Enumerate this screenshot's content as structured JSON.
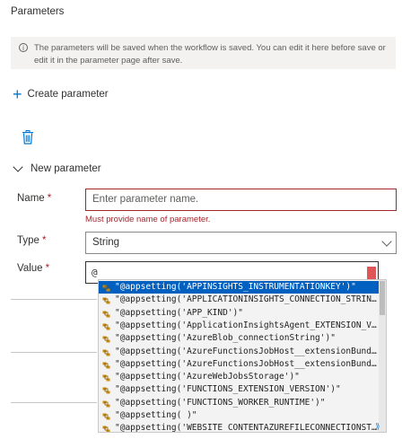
{
  "panel": {
    "title": "Parameters",
    "info_text": "The parameters will be saved when the workflow is saved. You can edit it here before save or edit it in the parameter page after save.",
    "create_label": "Create parameter",
    "section_title": "New parameter"
  },
  "form": {
    "name_label": "Name",
    "required_mark": "*",
    "name_placeholder": "Enter parameter name.",
    "name_value": "",
    "name_error": "Must provide name of parameter.",
    "type_label": "Type",
    "type_value": "String",
    "value_label": "Value",
    "value_text": "@"
  },
  "suggestions": [
    "\"@appsetting('APPINSIGHTS_INSTRUMENTATIONKEY')\"",
    "\"@appsetting('APPLICATIONINSIGHTS_CONNECTION_STRIN…",
    "\"@appsetting('APP_KIND')\"",
    "\"@appsetting('ApplicationInsightsAgent_EXTENSION_V…",
    "\"@appsetting('AzureBlob_connectionString')\"",
    "\"@appsetting('AzureFunctionsJobHost__extensionBund…",
    "\"@appsetting('AzureFunctionsJobHost__extensionBund…",
    "\"@appsetting('AzureWebJobsStorage')\"",
    "\"@appsetting('FUNCTIONS_EXTENSION_VERSION')\"",
    "\"@appsetting('FUNCTIONS_WORKER_RUNTIME')\"",
    "\"@appsetting(              )\"",
    "\"@appsetting('WEBSITE_CONTENTAZUREFILECONNECTIONST…"
  ],
  "colors": {
    "accent": "#0078d4",
    "error": "#a4262c",
    "selection": "#0060c0"
  }
}
